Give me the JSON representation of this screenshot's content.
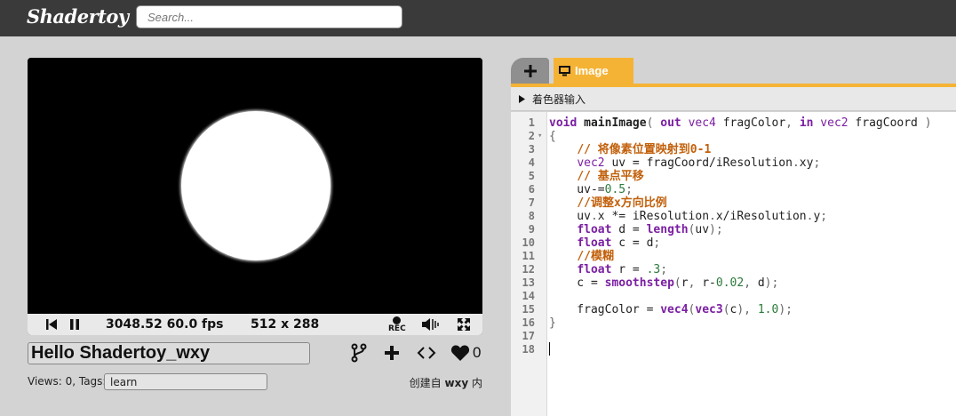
{
  "header": {
    "logo": "Shadertoy",
    "search_placeholder": "Search..."
  },
  "player": {
    "fps_text": "3048.52 60.0 fps",
    "resolution_text": "512 x 288",
    "rec_label": "REC"
  },
  "shader_info": {
    "title": "Hello Shadertoy_wxy",
    "views_text": "Views: 0, Tags:",
    "tags": "learn",
    "likes": "0",
    "created_by_prefix": "创建自",
    "author": "wxy",
    "created_by_suffix": "内"
  },
  "editor": {
    "add_tab_label": "+",
    "active_tab": "Image",
    "uniforms_label": "着色器输入",
    "colors": {
      "accent": "#f5b335",
      "keyword": "#7b1fa2",
      "comment": "#c2610c",
      "number": "#2b7a3b"
    },
    "lines": [
      {
        "n": "1",
        "fold": "",
        "tokens": [
          [
            "kw",
            "void"
          ],
          [
            "",
            " "
          ],
          [
            "fn",
            "mainImage"
          ],
          [
            "pu",
            "( "
          ],
          [
            "kw",
            "out"
          ],
          [
            "",
            ""
          ],
          [
            "",
            " "
          ],
          [
            "ty",
            "vec4"
          ],
          [
            "",
            ""
          ],
          [
            "",
            " fragColor"
          ],
          [
            "pu",
            ","
          ],
          [
            "",
            " "
          ],
          [
            "kw",
            "in"
          ],
          [
            "",
            " "
          ],
          [
            "ty",
            "vec2"
          ],
          [
            "",
            " fragCoord "
          ],
          [
            "pu",
            ")"
          ]
        ]
      },
      {
        "n": "2",
        "fold": "▾",
        "tokens": [
          [
            "pu",
            "{"
          ]
        ]
      },
      {
        "n": "3",
        "fold": "",
        "tokens": [
          [
            "",
            "    "
          ],
          [
            "cm",
            "// 将像素位置映射到0-1"
          ]
        ]
      },
      {
        "n": "4",
        "fold": "",
        "tokens": [
          [
            "",
            "    "
          ],
          [
            "ty",
            "vec2"
          ],
          [
            "",
            " uv = fragCoord/iResolution"
          ],
          [
            "pu",
            "."
          ],
          [
            "",
            "xy"
          ],
          [
            "pu",
            ";"
          ]
        ]
      },
      {
        "n": "5",
        "fold": "",
        "tokens": [
          [
            "",
            "    "
          ],
          [
            "cm",
            "// 基点平移"
          ]
        ]
      },
      {
        "n": "6",
        "fold": "",
        "tokens": [
          [
            "",
            "    uv-="
          ],
          [
            "nm",
            "0.5"
          ],
          [
            "pu",
            ";"
          ]
        ]
      },
      {
        "n": "7",
        "fold": "",
        "tokens": [
          [
            "",
            "    "
          ],
          [
            "cm",
            "//调整x方向比例"
          ]
        ]
      },
      {
        "n": "8",
        "fold": "",
        "tokens": [
          [
            "",
            "    uv"
          ],
          [
            "pu",
            "."
          ],
          [
            "",
            "x *= iResolution"
          ],
          [
            "pu",
            "."
          ],
          [
            "",
            "x/iResolution"
          ],
          [
            "pu",
            "."
          ],
          [
            "",
            "y"
          ],
          [
            "pu",
            ";"
          ]
        ]
      },
      {
        "n": "9",
        "fold": "",
        "tokens": [
          [
            "",
            "    "
          ],
          [
            "kw",
            "float"
          ],
          [
            "",
            " d = "
          ],
          [
            "kw",
            "length"
          ],
          [
            "pu",
            "("
          ],
          [
            "",
            "uv"
          ],
          [
            "pu",
            ");"
          ]
        ]
      },
      {
        "n": "10",
        "fold": "",
        "tokens": [
          [
            "",
            "    "
          ],
          [
            "kw",
            "float"
          ],
          [
            "",
            " c = d"
          ],
          [
            "pu",
            ";"
          ]
        ]
      },
      {
        "n": "11",
        "fold": "",
        "tokens": [
          [
            "",
            "    "
          ],
          [
            "cm",
            "//模糊"
          ]
        ]
      },
      {
        "n": "12",
        "fold": "",
        "tokens": [
          [
            "",
            "    "
          ],
          [
            "kw",
            "float"
          ],
          [
            "",
            " r = "
          ],
          [
            "nm",
            "."
          ],
          [
            "nm",
            "3"
          ],
          [
            "pu",
            ";"
          ]
        ]
      },
      {
        "n": "13",
        "fold": "",
        "tokens": [
          [
            "",
            "    c = "
          ],
          [
            "kw",
            "smoothstep"
          ],
          [
            "pu",
            "("
          ],
          [
            "",
            "r"
          ],
          [
            "pu",
            ","
          ],
          [
            "",
            " r-"
          ],
          [
            "nm",
            "0.02"
          ],
          [
            "pu",
            ","
          ],
          [
            "",
            " d"
          ],
          [
            "pu",
            ");"
          ]
        ]
      },
      {
        "n": "14",
        "fold": "",
        "tokens": []
      },
      {
        "n": "15",
        "fold": "",
        "tokens": [
          [
            "",
            "    fragColor = "
          ],
          [
            "kw",
            "vec4"
          ],
          [
            "pu",
            "("
          ],
          [
            "kw",
            "vec3"
          ],
          [
            "pu",
            "("
          ],
          [
            "",
            "c"
          ],
          [
            "pu",
            "),"
          ],
          [
            "",
            " "
          ],
          [
            "nm",
            "1.0"
          ],
          [
            "pu",
            ");"
          ]
        ]
      },
      {
        "n": "16",
        "fold": "",
        "tokens": [
          [
            "pu",
            "}"
          ]
        ]
      },
      {
        "n": "17",
        "fold": "",
        "tokens": []
      },
      {
        "n": "18",
        "fold": "",
        "tokens": []
      }
    ]
  }
}
